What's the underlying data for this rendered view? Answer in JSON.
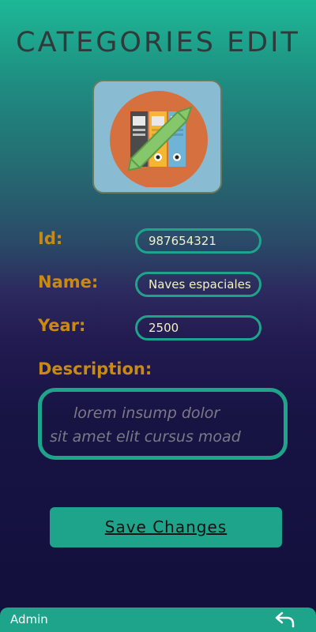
{
  "header": {
    "title": "CATEGORIES EDIT"
  },
  "form": {
    "id_label": "Id:",
    "id_value": "987654321",
    "name_label": "Name:",
    "name_value": "Naves espaciales",
    "year_label": "Year:",
    "year_value": "2500",
    "description_label": "Description:",
    "description_line1": "lorem insump dolor",
    "description_line2": "sit amet elit cursus moad"
  },
  "actions": {
    "save_label": "Save Changes"
  },
  "footer": {
    "user_label": "Admin",
    "back_icon": "back-arrow-icon"
  },
  "colors": {
    "accent": "#1fa48c",
    "label": "#c98a12",
    "title": "#2f3a3a"
  }
}
